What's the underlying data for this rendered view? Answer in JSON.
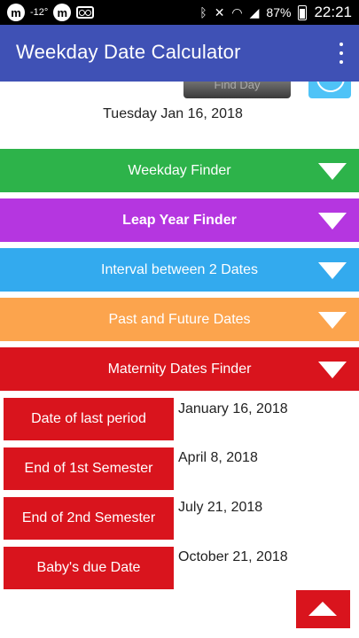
{
  "status_bar": {
    "temperature": "-12°",
    "battery": "87%",
    "time": "22:21",
    "icons": [
      "m-app-icon",
      "m-app-icon",
      "voicemail-icon",
      "bluetooth-icon",
      "mute-icon",
      "wifi-icon",
      "signal-icon",
      "battery-icon"
    ]
  },
  "app_bar": {
    "title": "Weekday Date Calculator",
    "menu_icon": "overflow-menu-icon"
  },
  "top_partial": {
    "button_label": "Find Day"
  },
  "result": {
    "date_text": "Tuesday  Jan 16, 2018"
  },
  "sections": [
    {
      "label": "Weekday Finder",
      "color": "#2db34a"
    },
    {
      "label": "Leap Year Finder",
      "color": "#b536e0"
    },
    {
      "label": "Interval between 2 Dates",
      "color": "#33aaee"
    },
    {
      "label": "Past and Future Dates",
      "color": "#fca44d"
    },
    {
      "label": "Maternity Dates Finder",
      "color": "#d9141d"
    }
  ],
  "maternity": [
    {
      "label": "Date of last period",
      "value": "January  16, 2018"
    },
    {
      "label": "End of 1st Semester",
      "value": "April  8, 2018"
    },
    {
      "label": "End of 2nd Semester",
      "value": "July  21, 2018"
    },
    {
      "label": "Baby's due Date",
      "value": "October  21, 2018"
    }
  ],
  "scroll_top_icon": "arrow-up-icon"
}
